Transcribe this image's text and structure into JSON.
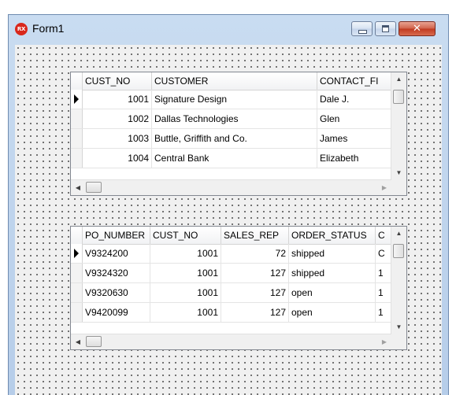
{
  "window": {
    "title": "Form1",
    "app_icon_text": "RX"
  },
  "grid1": {
    "columns": [
      "CUST_NO",
      "CUSTOMER",
      "CONTACT_FI"
    ],
    "rows": [
      [
        "1001",
        "Signature Design",
        "Dale J."
      ],
      [
        "1002",
        "Dallas Technologies",
        "Glen"
      ],
      [
        "1003",
        "Buttle, Griffith and Co.",
        "James"
      ],
      [
        "1004",
        "Central Bank",
        "Elizabeth"
      ]
    ]
  },
  "grid2": {
    "columns": [
      "PO_NUMBER",
      "CUST_NO",
      "SALES_REP",
      "ORDER_STATUS",
      "C"
    ],
    "rows": [
      [
        "V9324200",
        "1001",
        "72",
        "shipped",
        "C"
      ],
      [
        "V9324320",
        "1001",
        "127",
        "shipped",
        "1"
      ],
      [
        "V9320630",
        "1001",
        "127",
        "open",
        "1"
      ],
      [
        "V9420099",
        "1001",
        "127",
        "open",
        "1"
      ]
    ]
  },
  "icons": {
    "minimize": "minimize-icon",
    "maximize": "maximize-icon",
    "close": "close-icon",
    "row_indicator": "current-row-arrow-icon",
    "scroll_up": "scroll-up-arrow-icon",
    "scroll_down": "scroll-down-arrow-icon",
    "scroll_left": "scroll-left-arrow-icon",
    "scroll_right": "scroll-right-arrow-icon"
  },
  "colors": {
    "title_bar": "#c9dcf1",
    "close_button": "#c0391f",
    "form_background": "#f0f0f0"
  }
}
